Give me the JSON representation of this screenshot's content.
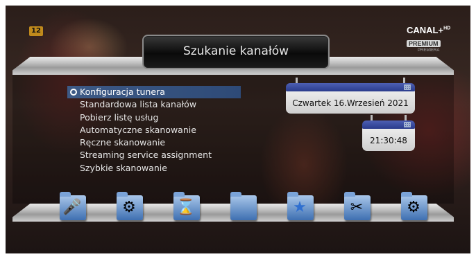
{
  "osd": {
    "age_rating": "12",
    "channel_logo": {
      "line1": "CANAL+",
      "hd": "HD",
      "line2": "PREMIUM",
      "line3": "PREMIERA"
    }
  },
  "header": {
    "title": "Szukanie kanałów"
  },
  "menu": {
    "items": [
      {
        "label": "Konfiguracja tunera",
        "selected": true
      },
      {
        "label": "Standardowa lista kanałów",
        "selected": false
      },
      {
        "label": "Pobierz listę usług",
        "selected": false
      },
      {
        "label": "Automatyczne skanowanie",
        "selected": false
      },
      {
        "label": "Ręczne skanowanie",
        "selected": false
      },
      {
        "label": "Streaming service assignment",
        "selected": false
      },
      {
        "label": "Szybkie skanowanie",
        "selected": false
      }
    ]
  },
  "widgets": {
    "date": "Czwartek  16.Wrzesień 2021",
    "time": "21:30:48"
  },
  "bottom_icons": [
    {
      "icon": "microphone-film-icon"
    },
    {
      "icon": "film-reel-icon"
    },
    {
      "icon": "hourglass-folder-icon"
    },
    {
      "icon": "folder-icon"
    },
    {
      "icon": "star-folder-icon"
    },
    {
      "icon": "tools-folder-icon"
    },
    {
      "icon": "gears-folder-icon"
    }
  ],
  "colors": {
    "selection": "#3d5a86",
    "title_text": "#e8e8e8",
    "calendar_cap": "#2a3b8c"
  }
}
